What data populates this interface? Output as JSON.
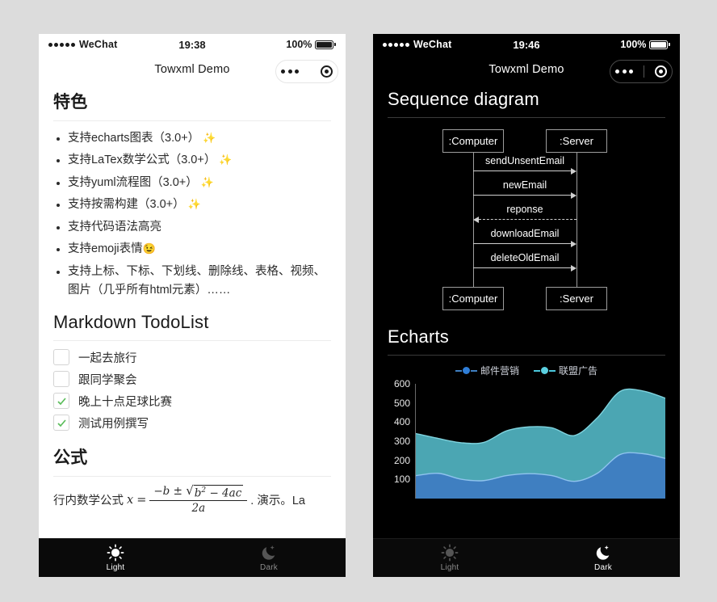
{
  "page": {
    "background": "#dcdcdc"
  },
  "left_phone": {
    "theme": "light",
    "status": {
      "carrier": "WeChat",
      "time": "19:38",
      "battery_percent": "100%"
    },
    "nav": {
      "title": "Towxml Demo",
      "menu_icon": "more-dots-icon",
      "target_icon": "capsule-target-icon"
    },
    "sections": {
      "features_title": "特色",
      "features": [
        {
          "text": "支持echarts图表（3.0+）",
          "emoji": "✨"
        },
        {
          "text": "支持LaTex数学公式（3.0+）",
          "emoji": "✨"
        },
        {
          "text": "支持yuml流程图（3.0+）",
          "emoji": "✨"
        },
        {
          "text": "支持按需构建（3.0+）",
          "emoji": "✨"
        },
        {
          "text": "支持代码语法高亮",
          "emoji": ""
        },
        {
          "text": "支持emoji表情",
          "emoji": "😉"
        },
        {
          "text": "支持上标、下标、下划线、删除线、表格、视频、图片（几乎所有html元素）……",
          "emoji": ""
        }
      ],
      "todo_title": "Markdown TodoList",
      "todos": [
        {
          "label": "一起去旅行",
          "checked": false
        },
        {
          "label": "跟同学聚会",
          "checked": false
        },
        {
          "label": "晚上十点足球比赛",
          "checked": true
        },
        {
          "label": "测试用例撰写",
          "checked": true
        }
      ],
      "formula_title": "公式",
      "formula_prefix": "行内数学公式",
      "formula": {
        "lhs": "x",
        "eq": "=",
        "numerator_lead": "−b ±",
        "radicand": "b",
        "radicand_exp": "2",
        "radicand_rest": "− 4ac",
        "denominator": "2a"
      },
      "formula_suffix": ". 演示。La"
    },
    "tabs": [
      {
        "label": "Light",
        "icon": "sun-icon",
        "active": true
      },
      {
        "label": "Dark",
        "icon": "moon-icon",
        "active": false
      }
    ]
  },
  "right_phone": {
    "theme": "dark",
    "status": {
      "carrier": "WeChat",
      "time": "19:46",
      "battery_percent": "100%"
    },
    "nav": {
      "title": "Towxml Demo",
      "menu_icon": "more-dots-icon",
      "target_icon": "capsule-target-icon"
    },
    "sequence": {
      "title": "Sequence diagram",
      "actors_top": [
        ":Computer",
        ":Server"
      ],
      "actors_bottom": [
        ":Computer",
        ":Server"
      ],
      "messages": [
        {
          "label": "sendUnsentEmail",
          "direction": "right",
          "style": "solid"
        },
        {
          "label": "newEmail",
          "direction": "right",
          "style": "solid"
        },
        {
          "label": "reponse",
          "direction": "left",
          "style": "dashed"
        },
        {
          "label": "downloadEmail",
          "direction": "right",
          "style": "solid"
        },
        {
          "label": "deleteOldEmail",
          "direction": "right",
          "style": "solid"
        }
      ]
    },
    "echarts": {
      "title": "Echarts"
    },
    "tabs": [
      {
        "label": "Light",
        "icon": "sun-icon",
        "active": false
      },
      {
        "label": "Dark",
        "icon": "moon-icon",
        "active": true
      }
    ]
  },
  "chart_data": {
    "type": "area",
    "stacked": true,
    "title": "Echarts",
    "xlabel": "",
    "ylabel": "",
    "ylim": [
      0,
      600
    ],
    "yticks": [
      100,
      200,
      300,
      400,
      500,
      600
    ],
    "grid": false,
    "legend_position": "top-center",
    "x": [
      1,
      2,
      3,
      4,
      5,
      6,
      7,
      8,
      9,
      10,
      11,
      12
    ],
    "series": [
      {
        "name": "邮件营销",
        "color": "#3f7fc1",
        "values": [
          120,
          132,
          101,
          94,
          120,
          130,
          120,
          90,
          132,
          230,
          235,
          210
        ]
      },
      {
        "name": "联盟广告",
        "color": "#4ba6b3",
        "values": [
          220,
          182,
          191,
          200,
          234,
          245,
          250,
          240,
          290,
          330,
          328,
          315
        ]
      }
    ]
  }
}
